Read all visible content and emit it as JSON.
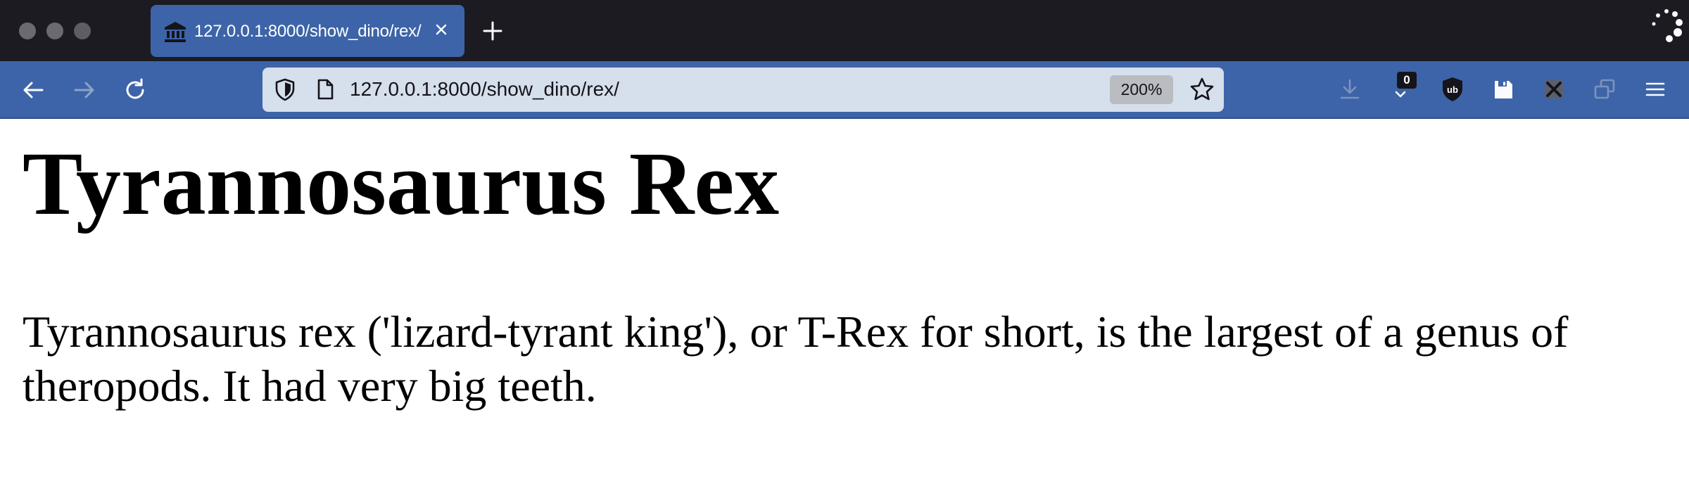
{
  "browser": {
    "tab": {
      "title": "127.0.0.1:8000/show_dino/rex/",
      "favicon": "bank-building-icon"
    },
    "toolbar": {
      "url": "127.0.0.1:8000/show_dino/rex/",
      "zoom": "200%",
      "extension_badge_count": "0"
    },
    "colors": {
      "titlebar": "#1c1b22",
      "toolbar": "#3d64a8",
      "urlbar": "#d6dfec",
      "zoom_badge": "#b9bcc1"
    },
    "icons": {
      "window_controls": [
        "close-dot",
        "minimize-dot",
        "zoom-dot"
      ],
      "tab_close": "close-icon",
      "new_tab": "plus-icon",
      "spinner": "loading-spinner-icon",
      "back": "arrow-left-icon",
      "forward": "arrow-right-icon",
      "reload": "reload-icon",
      "tracking_protection": "shield-icon",
      "page_info": "page-icon",
      "bookmark": "star-icon",
      "downloads": "download-icon",
      "ublock": "ublock-icon",
      "save": "floppy-disk-icon",
      "extension": "crossed-tool-icon",
      "window": "overlapping-windows-icon",
      "menu": "hamburger-menu-icon"
    }
  },
  "page": {
    "heading": "Tyrannosaurus Rex",
    "body": "Tyrannosaurus rex ('lizard-tyrant king'), or T-Rex for short, is the largest of a genus of theropods. It had very big teeth."
  }
}
